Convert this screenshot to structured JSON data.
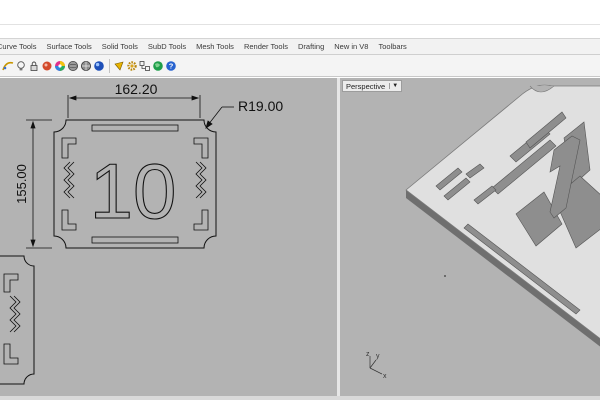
{
  "tabs": [
    {
      "label": "Curve Tools"
    },
    {
      "label": "Surface Tools"
    },
    {
      "label": "Solid Tools"
    },
    {
      "label": "SubD Tools"
    },
    {
      "label": "Mesh Tools"
    },
    {
      "label": "Render Tools"
    },
    {
      "label": "Drafting"
    },
    {
      "label": "New in V8"
    },
    {
      "label": "Toolbars"
    }
  ],
  "toolbar_icons": [
    "curve-tool-icon",
    "lightbulb-icon",
    "lock-icon",
    "material-icon",
    "color-wheel-icon",
    "render-sphere-icon",
    "environment-icon",
    "display-mode-icon",
    "pointer-icon",
    "gear-icon",
    "layout-icon",
    "globe-icon",
    "help-icon"
  ],
  "viewports": {
    "top": {
      "dimension_width": "162.20",
      "dimension_height": "155.00",
      "radius_label": "R19.00",
      "part_number": "10"
    },
    "perspective": {
      "label": "Perspective",
      "axis_z": "z",
      "axis_y": "y",
      "axis_x": "x"
    }
  }
}
